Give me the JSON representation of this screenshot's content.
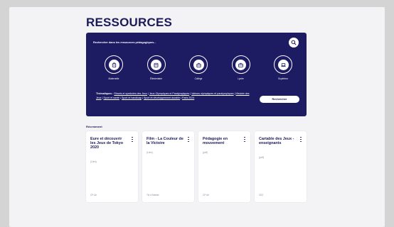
{
  "title": "RESSOURCES",
  "search": {
    "placeholder": "Rechercher dans les ressources pédagogiques..."
  },
  "levels": [
    {
      "label": "Maternelle",
      "icon": "backpack-icon"
    },
    {
      "label": "Élémentaire",
      "icon": "schoolbag-icon"
    },
    {
      "label": "Collège",
      "icon": "bag-icon"
    },
    {
      "label": "Lycée",
      "icon": "briefcase-icon"
    },
    {
      "label": "Supérieur",
      "icon": "laptop-icon"
    }
  ],
  "themes": {
    "label": "Thématiques :",
    "items": [
      "Rituels et symboles des Jeux",
      "Jeux Olympiques et Paralympiques",
      "Valeurs olympiques et paralympiques",
      "Histoire des Jeux",
      "Sport et santé",
      "Sport et handicap",
      "Sport et développement durable",
      "Paris 2024"
    ]
  },
  "submit_label": "Rechercher",
  "recent_label": "Récemment",
  "cards": [
    {
      "title": "Eure et découvrir les Jeux de Tokyo 2020",
      "meta": "(Lien)",
      "foot": "CP-6e"
    },
    {
      "title": "Film - La Couleur de la Victoire",
      "meta": "(Lien)",
      "foot": "Tle à Master"
    },
    {
      "title": "Pédagogie en mouvement",
      "meta": "(pdf)",
      "foot": "CP-6e"
    },
    {
      "title": "Cartable des Jeux - enseignants",
      "meta": "(pdf)",
      "foot": "CE2"
    }
  ],
  "colors": {
    "navy": "#1d1b61",
    "page_bg": "#f3f3f5",
    "outer_bg": "#d4d4d4"
  }
}
